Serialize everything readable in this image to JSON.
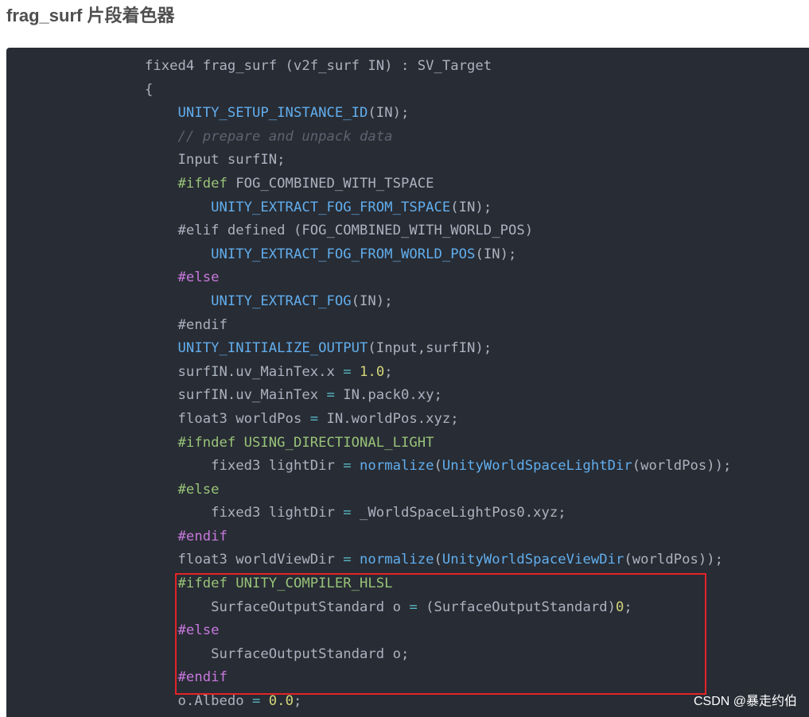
{
  "heading": "frag_surf 片段着色器",
  "watermark": "CSDN @暴走约伯",
  "colors": {
    "page_background": "#ffffff",
    "heading": "#4f4f4f",
    "code_background": "#282c34",
    "code_text": "#abb2bf",
    "highlight_box": "#e32428",
    "watermark": "#ffffff"
  },
  "code": {
    "lines": [
      {
        "tokens": [
          {
            "t": "fixed4 frag_surf (v2f_surf IN) : SV_Target"
          }
        ]
      },
      {
        "tokens": [
          {
            "t": "{"
          }
        ]
      },
      {
        "tokens": [
          {
            "t": "    "
          },
          {
            "t": "UNITY_SETUP_INSTANCE_ID",
            "color": "#61aeee"
          },
          {
            "t": "(IN);"
          }
        ]
      },
      {
        "tokens": [
          {
            "t": "    "
          },
          {
            "t": "// prepare and unpack data",
            "color": "#5c6370",
            "italic": true
          }
        ]
      },
      {
        "tokens": [
          {
            "t": "    "
          },
          {
            "t": "Input surfIN;"
          }
        ]
      },
      {
        "tokens": [
          {
            "t": "    "
          },
          {
            "t": "#ifdef",
            "color": "#98c379"
          },
          {
            "t": " FOG_COMBINED_WITH_TSPACE"
          }
        ]
      },
      {
        "tokens": [
          {
            "t": "        "
          },
          {
            "t": "UNITY_EXTRACT_FOG_FROM_TSPACE",
            "color": "#61aeee"
          },
          {
            "t": "(IN);"
          }
        ]
      },
      {
        "tokens": [
          {
            "t": "    "
          },
          {
            "t": "#elif defined (FOG_COMBINED_WITH_WORLD_POS)"
          }
        ]
      },
      {
        "tokens": [
          {
            "t": "        "
          },
          {
            "t": "UNITY_EXTRACT_FOG_FROM_WORLD_POS",
            "color": "#61aeee"
          },
          {
            "t": "(IN);"
          }
        ]
      },
      {
        "tokens": [
          {
            "t": "    "
          },
          {
            "t": "#else",
            "color": "#c678dd"
          }
        ]
      },
      {
        "tokens": [
          {
            "t": "        "
          },
          {
            "t": "UNITY_EXTRACT_FOG",
            "color": "#61aeee"
          },
          {
            "t": "(IN);"
          }
        ]
      },
      {
        "tokens": [
          {
            "t": "    "
          },
          {
            "t": "#endif"
          }
        ]
      },
      {
        "tokens": [
          {
            "t": "    "
          },
          {
            "t": "UNITY_INITIALIZE_OUTPUT",
            "color": "#61aeee"
          },
          {
            "t": "(Input,surfIN);"
          }
        ]
      },
      {
        "tokens": [
          {
            "t": "    "
          },
          {
            "t": "surfIN.uv_MainTex.x "
          },
          {
            "t": "=",
            "color": "#56b6c2"
          },
          {
            "t": " "
          },
          {
            "t": "1.0",
            "color": "#d4d67a"
          },
          {
            "t": ";"
          }
        ]
      },
      {
        "tokens": [
          {
            "t": "    "
          },
          {
            "t": "surfIN.uv_MainTex "
          },
          {
            "t": "=",
            "color": "#56b6c2"
          },
          {
            "t": " IN.pack0.xy;"
          }
        ]
      },
      {
        "tokens": [
          {
            "t": "    "
          },
          {
            "t": "float3 worldPos "
          },
          {
            "t": "=",
            "color": "#56b6c2"
          },
          {
            "t": " IN.worldPos.xyz;"
          }
        ]
      },
      {
        "tokens": [
          {
            "t": "    "
          },
          {
            "t": "#ifndef USING_DIRECTIONAL_LIGHT",
            "color": "#98c379"
          }
        ]
      },
      {
        "tokens": [
          {
            "t": "        "
          },
          {
            "t": "fixed3 lightDir "
          },
          {
            "t": "=",
            "color": "#56b6c2"
          },
          {
            "t": " "
          },
          {
            "t": "normalize",
            "color": "#61aeee"
          },
          {
            "t": "("
          },
          {
            "t": "UnityWorldSpaceLightDir",
            "color": "#61aeee"
          },
          {
            "t": "(worldPos));"
          }
        ]
      },
      {
        "tokens": [
          {
            "t": "    "
          },
          {
            "t": "#else",
            "color": "#98c379"
          }
        ]
      },
      {
        "tokens": [
          {
            "t": "        "
          },
          {
            "t": "fixed3 lightDir "
          },
          {
            "t": "=",
            "color": "#56b6c2"
          },
          {
            "t": " _WorldSpaceLightPos0.xyz;"
          }
        ]
      },
      {
        "tokens": [
          {
            "t": "    "
          },
          {
            "t": "#endif",
            "color": "#c678dd"
          }
        ]
      },
      {
        "tokens": [
          {
            "t": "    "
          },
          {
            "t": "float3 worldViewDir "
          },
          {
            "t": "=",
            "color": "#56b6c2"
          },
          {
            "t": " "
          },
          {
            "t": "normalize",
            "color": "#61aeee"
          },
          {
            "t": "("
          },
          {
            "t": "UnityWorldSpaceViewDir",
            "color": "#61aeee"
          },
          {
            "t": "(worldPos));"
          }
        ]
      },
      {
        "tokens": [
          {
            "t": "    "
          },
          {
            "t": "#ifdef UNITY_COMPILER_HLSL",
            "color": "#98c379"
          }
        ]
      },
      {
        "tokens": [
          {
            "t": "        "
          },
          {
            "t": "SurfaceOutputStandard o "
          },
          {
            "t": "=",
            "color": "#56b6c2"
          },
          {
            "t": " (SurfaceOutputStandard)"
          },
          {
            "t": "0",
            "color": "#d4d67a"
          },
          {
            "t": ";"
          }
        ]
      },
      {
        "tokens": [
          {
            "t": "    "
          },
          {
            "t": "#else",
            "color": "#c678dd"
          }
        ]
      },
      {
        "tokens": [
          {
            "t": "        "
          },
          {
            "t": "SurfaceOutputStandard o;"
          }
        ]
      },
      {
        "tokens": [
          {
            "t": "    "
          },
          {
            "t": "#endif",
            "color": "#c678dd"
          }
        ]
      },
      {
        "tokens": [
          {
            "t": "    "
          },
          {
            "t": "o.Albedo "
          },
          {
            "t": "=",
            "color": "#56b6c2"
          },
          {
            "t": " "
          },
          {
            "t": "0.0",
            "color": "#d4d67a"
          },
          {
            "t": ";"
          }
        ]
      }
    ]
  }
}
